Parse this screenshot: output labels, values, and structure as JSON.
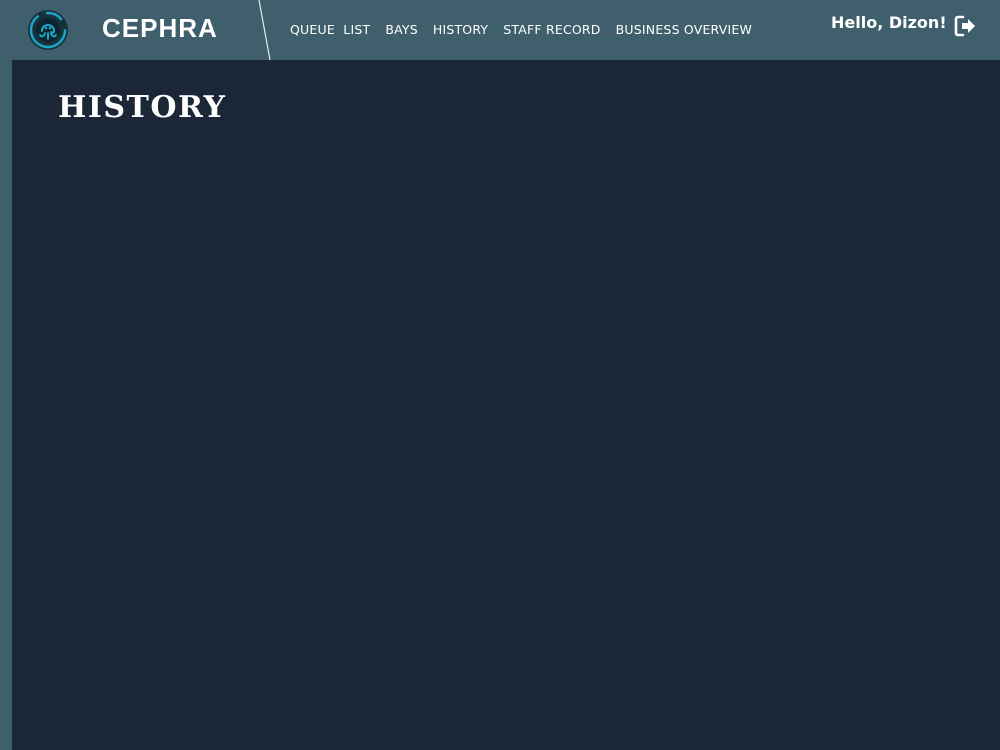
{
  "header": {
    "brand": "CEPHRA",
    "nav": [
      {
        "label": "QUEUE  LIST"
      },
      {
        "label": "BAYS"
      },
      {
        "label": "HISTORY"
      },
      {
        "label": "STAFF RECORD"
      },
      {
        "label": "BUSINESS OVERVIEW"
      }
    ],
    "greeting": "Hello, Dizon!",
    "logout_icon": "logout-icon",
    "logo_icon": "octopus-logo-icon"
  },
  "main": {
    "title": "HISTORY"
  },
  "colors": {
    "header_bg": "#405f6d",
    "content_bg": "#1b2736",
    "logo_accent": "#1aa6c6",
    "text": "#ffffff"
  }
}
